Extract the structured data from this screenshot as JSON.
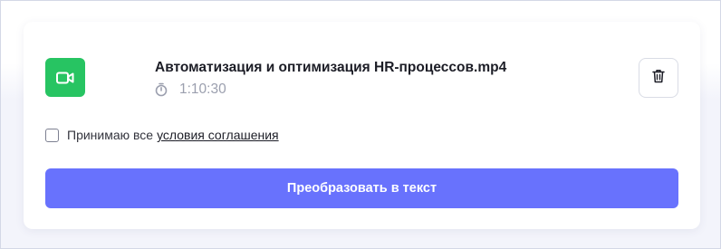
{
  "file": {
    "name": "Автоматизация и оптимизация HR-процессов.mp4",
    "duration": "1:10:30",
    "icon": "video-camera-icon",
    "icon_color": "#27c462"
  },
  "actions": {
    "delete_icon": "trash-icon"
  },
  "agreement": {
    "checked": false,
    "text": "Принимаю все",
    "link_text": "условия соглашения"
  },
  "convert_button": {
    "label": "Преобразовать в текст",
    "color": "#6872fd"
  }
}
